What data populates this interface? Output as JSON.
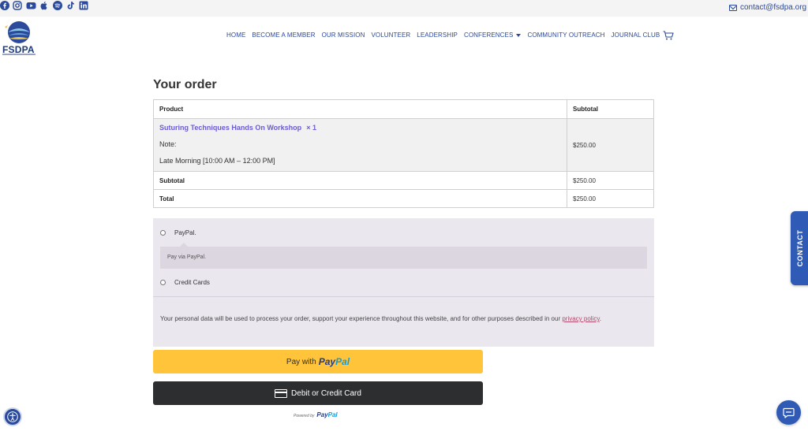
{
  "topbar": {
    "social_icons": [
      "facebook-icon",
      "instagram-icon",
      "youtube-icon",
      "apple-icon",
      "spotify-icon",
      "tiktok-icon",
      "linkedin-icon"
    ],
    "email": "contact@fsdpa.org"
  },
  "brand": {
    "name": "FSDPA",
    "colors": {
      "primary": "#2b4a9b",
      "link": "#6b5bd6",
      "paypal_yellow": "#ffc439",
      "dark_button": "#2c2e2f"
    }
  },
  "nav": {
    "items": [
      "HOME",
      "BECOME A MEMBER",
      "OUR MISSION",
      "VOLUNTEER",
      "LEADERSHIP",
      "CONFERENCES",
      "COMMUNITY OUTREACH",
      "JOURNAL CLUB"
    ],
    "cart_icon": "cart-icon"
  },
  "order": {
    "heading": "Your order",
    "columns": [
      "Product",
      "Subtotal"
    ],
    "product": {
      "name": "Suturing Techniques Hands On Workshop",
      "qty": "× 1",
      "note_label": "Note:",
      "slot": "Late Morning [10:00 AM – 12:00 PM]",
      "price": "$250.00"
    },
    "subtotal_label": "Subtotal",
    "subtotal_value": "$250.00",
    "total_label": "Total",
    "total_value": "$250.00"
  },
  "payment": {
    "paypal_label": "PayPal.",
    "paypal_desc": "Pay via PayPal.",
    "card_label": "Credit Cards",
    "privacy_text": "Your personal data will be used to process your order, support your experience throughout this website, and for other purposes described in our ",
    "privacy_link": "privacy policy",
    "privacy_end": "."
  },
  "buttons": {
    "pay_with": "Pay with",
    "paypal_pay": "Pay",
    "paypal_pal": "Pal",
    "card": "Debit or Credit Card",
    "powered_by": "Powered by"
  },
  "side": {
    "contact_tab": "CONTACT"
  }
}
